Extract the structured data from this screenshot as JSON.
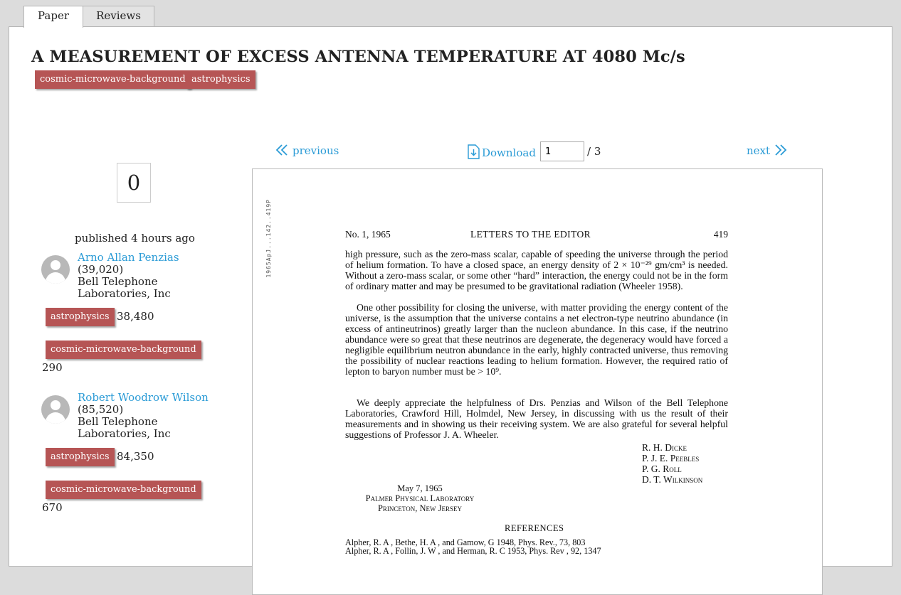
{
  "tabs": [
    {
      "label": "Paper",
      "active": true
    },
    {
      "label": "Reviews",
      "active": false
    }
  ],
  "paper": {
    "title": "A MEASUREMENT OF EXCESS ANTENNA TEMPERATURE AT 4080 Mc/s",
    "tags": [
      "cosmic-microwave-background",
      "astrophysics"
    ],
    "vote_count": "0",
    "published": "published 4 hours ago"
  },
  "authors": [
    {
      "name": "Arno Allan Penzias",
      "score": "(39,020)",
      "affiliation_line1": "Bell Telephone",
      "affiliation_line2": "Laboratories, Inc",
      "tag_scores": [
        {
          "tag": "astrophysics",
          "score": "38,480"
        },
        {
          "tag": "cosmic-microwave-background",
          "score": "290"
        }
      ]
    },
    {
      "name": "Robert Woodrow Wilson",
      "score": "(85,520)",
      "affiliation_line1": "Bell Telephone",
      "affiliation_line2": "Laboratories, Inc",
      "tag_scores": [
        {
          "tag": "astrophysics",
          "score": "84,350"
        },
        {
          "tag": "cosmic-microwave-background",
          "score": "670"
        }
      ]
    }
  ],
  "viewer": {
    "previous_label": "previous",
    "download_label": "Download",
    "page_value": "1",
    "page_total": "/ 3",
    "next_label": "next"
  },
  "document": {
    "stamp": "1965ApJ...142..419P",
    "header_left": "No. 1, 1965",
    "header_center": "LETTERS TO THE EDITOR",
    "header_right": "419",
    "para1": "high pressure, such as the zero-mass scalar, capable of speeding the universe through the period of helium formation. To have a closed space, an energy density of 2 × 10⁻²⁹ gm/cm³ is needed. Without a zero-mass scalar, or some other “hard” interaction, the energy could not be in the form of ordinary matter and may be presumed to be gravitational radiation (Wheeler 1958).",
    "para2": "One other possibility for closing the universe, with matter providing the energy content of the universe, is the assumption that the universe contains a net electron-type neutrino abundance (in excess of antineutrinos) greatly larger than the nucleon abundance. In this case, if the neutrino abundance were so great that these neutrinos are degenerate, the degeneracy would have forced a negligible equilibrium neutron abundance in the early, highly contracted universe, thus removing the possibility of nuclear reactions leading to helium formation. However, the required ratio of lepton to baryon number must be > 10⁹.",
    "para3": "We deeply appreciate the helpfulness of Drs. Penzias and Wilson of the Bell Telephone Laboratories, Crawford Hill, Holmdel, New Jersey, in discussing with us the result of their measurements and in showing us their receiving system. We are also grateful for several helpful suggestions of Professor J. A. Wheeler.",
    "signatories": [
      "R. H. Dicke",
      "P. J. E. Peebles",
      "P. G. Roll",
      "D. T. Wilkinson"
    ],
    "date": "May 7, 1965",
    "lab": "Palmer Physical Laboratory",
    "place": "Princeton, New Jersey",
    "references_heading": "REFERENCES",
    "ref1": "Alpher, R. A , Bethe, H. A , and Gamow, G  1948, Phys. Rev., 73, 803",
    "ref2": "Alpher, R. A , Follin, J. W , and Herman, R. C  1953, Phys. Rev , 92, 1347"
  },
  "colors": {
    "tag_bg": "#b65555",
    "link": "#2a9bd6",
    "page_bg": "#dcdcdc"
  }
}
